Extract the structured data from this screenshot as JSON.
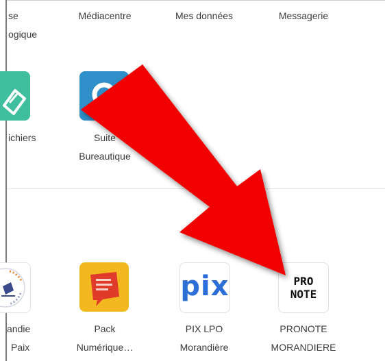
{
  "top_row": {
    "col1_line1": "se",
    "col1_line2": "ogique",
    "col2": "Médiacentre",
    "col3": "Mes données",
    "col4": "Messagerie"
  },
  "row2": {
    "fichiers_label": "ichiers",
    "suite_line1": "Suite",
    "suite_line2": "Bureautique"
  },
  "row3": {
    "lycee_line1": "andie",
    "lycee_line2": "Paix",
    "pack_line1": "Pack",
    "pack_line2": "Numérique…",
    "pix_line1": "PIX LPO",
    "pix_line2": "Morandière",
    "pronote_line1": "PRONOTE",
    "pronote_line2": "MORANDIERE"
  },
  "logos": {
    "pix": "pix",
    "pronote_top": "PRO",
    "pronote_bottom": "NOTE",
    "pack": "#Pack Numérique Lycées",
    "lycee_seal": "LYCÉE LA PAIX"
  },
  "colors": {
    "arrow": "#f20000",
    "fichiers": "#3fbf9e",
    "suite": "#2f8fc9",
    "pack": "#f3b81f",
    "pix": "#2d6fd6"
  },
  "icons": [
    "fichiers-icon",
    "suite-bureautique-icon",
    "lycee-seal-icon",
    "pack-numerique-icon",
    "pix-logo",
    "pronote-logo",
    "red-arrow"
  ]
}
